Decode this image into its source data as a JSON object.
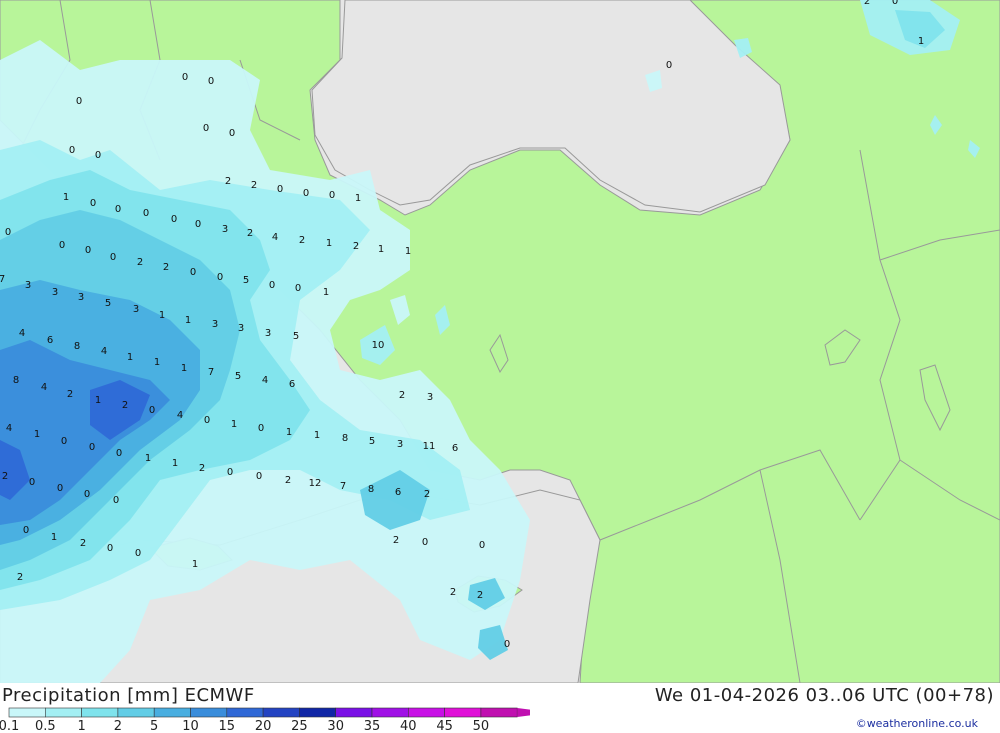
{
  "title": "Precipitation [mm] ECMWF",
  "run": "We 01-04-2026 03..06 UTC (00+78)",
  "credit": "©weatheronline.co.uk",
  "colors": {
    "land": "#b8f59a",
    "sea": "#e6e6e6",
    "border": "#999999",
    "p01": "#c9f7f9",
    "p05": "#a3eff3",
    "p1": "#7fe3ec",
    "p2": "#62cde6",
    "p5": "#49aee0",
    "p10": "#3a8ddb",
    "p15": "#2f68d6",
    "p20": "#2343c2",
    "p25": "#1026a6",
    "p30": "#7a10e6",
    "p35": "#a010e6",
    "p40": "#c810e6",
    "p45": "#e010d8",
    "p50": "#c010b0"
  },
  "legend": {
    "labels": [
      "0.1",
      "0.5",
      "1",
      "2",
      "5",
      "10",
      "15",
      "20",
      "25",
      "30",
      "35",
      "40",
      "45",
      "50"
    ],
    "colors": [
      "#c9f7f9",
      "#a3eff3",
      "#7fe3ec",
      "#62cde6",
      "#49aee0",
      "#3a8ddb",
      "#2f68d6",
      "#2343c2",
      "#1026a6",
      "#7a10e6",
      "#a010e6",
      "#c810e6",
      "#e010d8",
      "#c010b0"
    ]
  },
  "values": [
    "0",
    "0",
    "0",
    "0",
    "0",
    "0",
    "0",
    "2",
    "0",
    "1",
    "0",
    "2",
    "2",
    "1",
    "0",
    "0",
    "0",
    "0",
    "0",
    "0",
    "1",
    "0",
    "0",
    "0",
    "0",
    "0",
    "2",
    "0",
    "3",
    "2",
    "4",
    "2",
    "1",
    "2",
    "1",
    "1",
    "2",
    "0",
    "0",
    "5",
    "0",
    "0",
    "1",
    "7",
    "3",
    "3",
    "3",
    "5",
    "3",
    "1",
    "1",
    "3",
    "3",
    "3",
    "5",
    "4",
    "6",
    "8",
    "4",
    "1",
    "1",
    "1",
    "7",
    "5",
    "4",
    "6",
    "10",
    "8",
    "4",
    "2",
    "1",
    "2",
    "0",
    "4",
    "0",
    "1",
    "0",
    "1",
    "1",
    "8",
    "5",
    "3",
    "11",
    "6",
    "4",
    "1",
    "0",
    "0",
    "0",
    "1",
    "1",
    "2",
    "0",
    "0",
    "2",
    "12",
    "7",
    "8",
    "6",
    "2",
    "2",
    "3",
    "2",
    "0",
    "0",
    "0",
    "0",
    "0",
    "1",
    "2",
    "0",
    "0",
    "1",
    "2",
    "0",
    "0",
    "2",
    "2",
    "0",
    "2"
  ]
}
